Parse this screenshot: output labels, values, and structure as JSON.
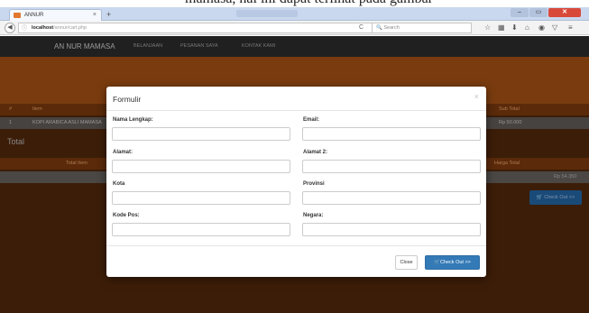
{
  "caption": {
    "text": "mamasa, hal ini dapat terlihat pada gambar"
  },
  "browser": {
    "tab_title": "ANNUR",
    "tab_close": "×",
    "new_tab": "+",
    "window_minimize": "–",
    "window_maximize": "▭",
    "window_close": "✕",
    "url_host": "localhost",
    "url_path": "/annur/cart.php",
    "search_placeholder": "Search"
  },
  "site": {
    "brand": "AN NUR MAMASA",
    "nav": [
      "BELANJAAN",
      "PESANAN SAYA",
      "KONTAK KAMI"
    ]
  },
  "cart": {
    "headers": [
      "#",
      "Item",
      "Sub Total"
    ],
    "rows": [
      {
        "no": "1",
        "item": "KOPI ARABICA ASLI MAMASA",
        "subtotal": "Rp 50.000"
      }
    ],
    "total_heading": "Total",
    "total_item_label": "Total Item",
    "grand_total_label": "Harga Total",
    "grand_total_value": "Rp 54.350",
    "checkout_label": "Check Out >>"
  },
  "modal": {
    "title": "Formulir",
    "close_x": "×",
    "fields": {
      "nama": "Nama Lengkap:",
      "email": "Email:",
      "alamat": "Alamat:",
      "alamat2": "Alamat 2:",
      "kota": "Kota",
      "provinsi": "Provinsi",
      "kodepos": "Kode Pos:",
      "negara": "Negara:"
    },
    "close_button": "Close",
    "checkout_button": "Check Out >>"
  },
  "colors": {
    "accent": "#337ab7",
    "navbar": "#202020",
    "header_dim": "#7a3c0f"
  }
}
